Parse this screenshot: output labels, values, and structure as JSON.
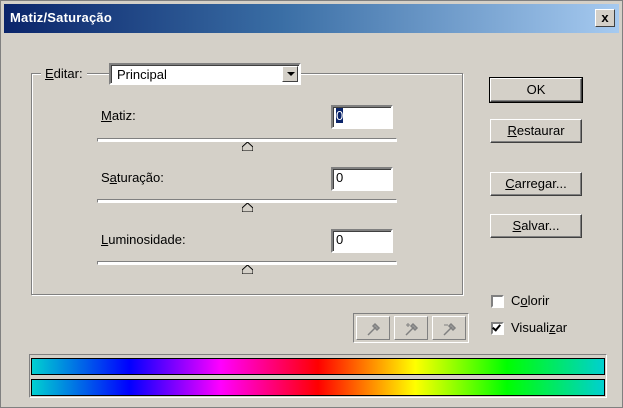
{
  "window": {
    "title": "Matiz/Saturação",
    "close_label": "x"
  },
  "editor": {
    "label_accel": "E",
    "label_rest": "ditar:",
    "selected": "Principal"
  },
  "sliders": [
    {
      "label_accel": "M",
      "label_rest": "atiz:",
      "value": "0",
      "selected": true
    },
    {
      "label_pre": "S",
      "label_accel": "a",
      "label_rest": "turação:",
      "value": "0",
      "selected": false
    },
    {
      "label_accel": "L",
      "label_rest": "uminosidade:",
      "value": "0",
      "selected": false
    }
  ],
  "buttons": {
    "ok": "OK",
    "restaurar_accel": "R",
    "restaurar_rest": "estaurar",
    "carregar_accel": "C",
    "carregar_rest": "arregar...",
    "salvar_accel": "S",
    "salvar_rest": "alvar..."
  },
  "checkboxes": {
    "colorir": {
      "pre": "C",
      "accel": "o",
      "rest": "lorir",
      "checked": false
    },
    "visualizar": {
      "pre": "Visuali",
      "accel": "z",
      "rest": "ar",
      "checked": true
    }
  },
  "icons": [
    "eyedropper-icon",
    "eyedropper-plus-icon",
    "eyedropper-minus-icon"
  ],
  "colors": {
    "dialog_bg": "#d4d0c8",
    "title_start": "#0a246a",
    "title_end": "#a6caf0"
  }
}
